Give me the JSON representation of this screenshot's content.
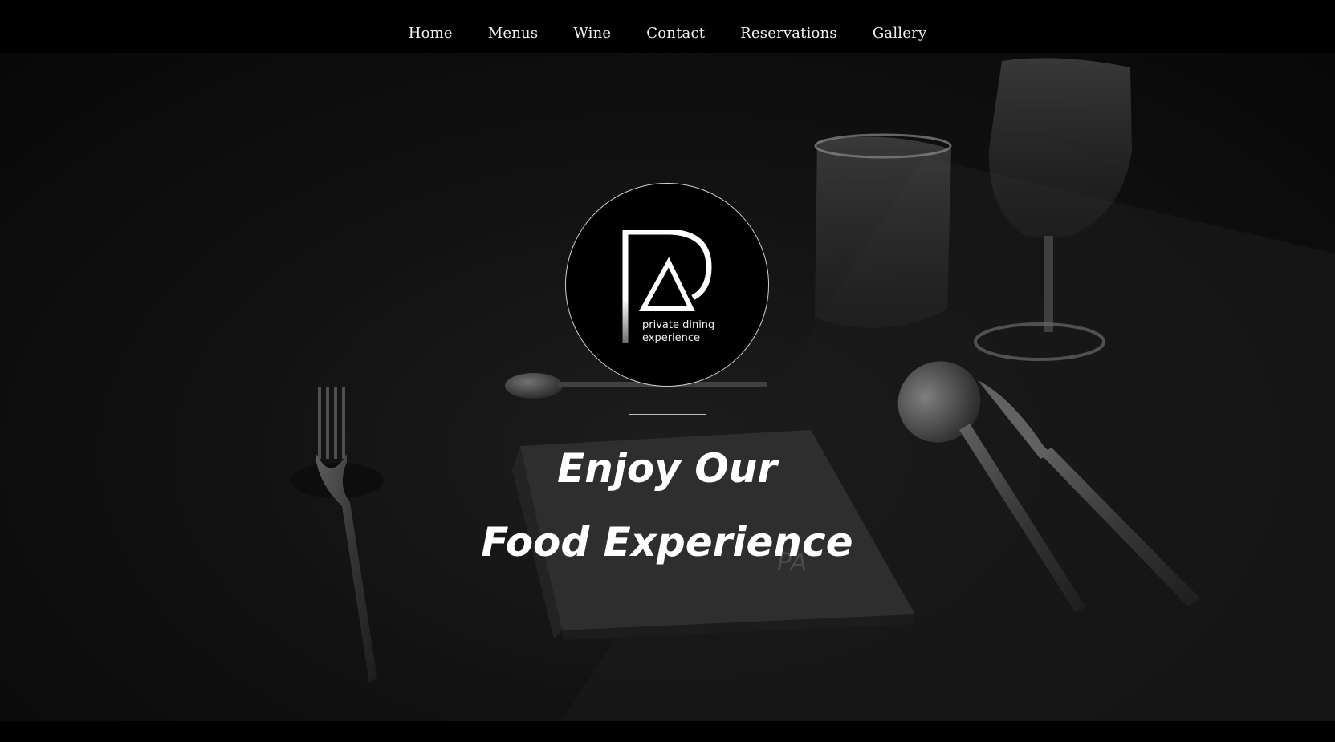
{
  "nav": {
    "items": [
      {
        "label": "Home"
      },
      {
        "label": "Menus"
      },
      {
        "label": "Wine"
      },
      {
        "label": "Contact"
      },
      {
        "label": "Reservations"
      },
      {
        "label": "Gallery"
      }
    ]
  },
  "logo": {
    "line1": "private dining",
    "line2": "experience"
  },
  "hero": {
    "headline_line1": "Enjoy Our",
    "headline_line2": "Food Experience"
  },
  "colors": {
    "background": "#000000",
    "text": "#ffffff"
  }
}
